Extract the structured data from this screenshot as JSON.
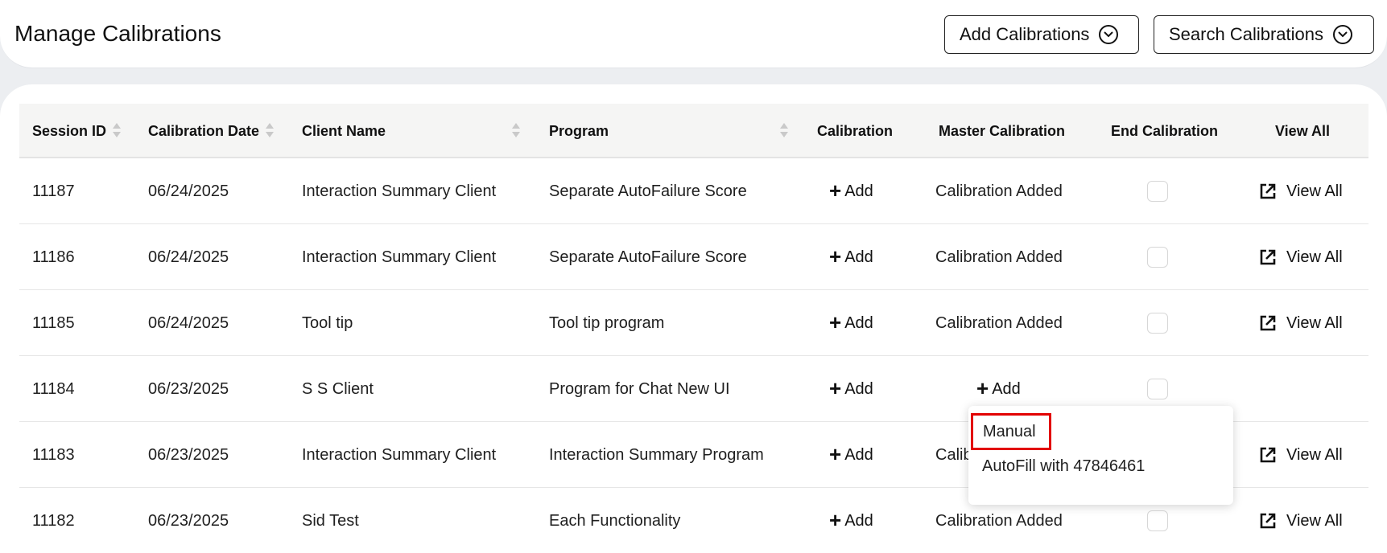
{
  "header": {
    "title": "Manage Calibrations",
    "add_button": "Add Calibrations",
    "search_button": "Search Calibrations"
  },
  "table": {
    "columns": [
      "Session ID",
      "Calibration Date",
      "Client Name",
      "Program",
      "Calibration",
      "Master Calibration",
      "End Calibration",
      "View All"
    ],
    "rows": [
      {
        "session_id": "11187",
        "date": "06/24/2025",
        "client": "Interaction Summary Client",
        "program": "Separate AutoFailure Score",
        "calibration": "Add",
        "master": "Calibration Added",
        "view_all": "View All"
      },
      {
        "session_id": "11186",
        "date": "06/24/2025",
        "client": "Interaction Summary Client",
        "program": "Separate AutoFailure Score",
        "calibration": "Add",
        "master": "Calibration Added",
        "view_all": "View All"
      },
      {
        "session_id": "11185",
        "date": "06/24/2025",
        "client": "Tool tip",
        "program": "Tool tip program",
        "calibration": "Add",
        "master": "Calibration Added",
        "view_all": "View All"
      },
      {
        "session_id": "11184",
        "date": "06/23/2025",
        "client": "S S Client",
        "program": "Program for Chat New UI",
        "calibration": "Add",
        "master": "Add",
        "view_all": ""
      },
      {
        "session_id": "11183",
        "date": "06/23/2025",
        "client": "Interaction Summary Client",
        "program": "Interaction Summary Program",
        "calibration": "Add",
        "master": "Calib",
        "view_all": "View All"
      },
      {
        "session_id": "11182",
        "date": "06/23/2025",
        "client": "Sid Test",
        "program": "Each Functionality",
        "calibration": "Add",
        "master": "Calibration Added",
        "view_all": "View All"
      }
    ]
  },
  "dropdown": {
    "items": [
      "Manual",
      "AutoFill with 47846461"
    ]
  }
}
